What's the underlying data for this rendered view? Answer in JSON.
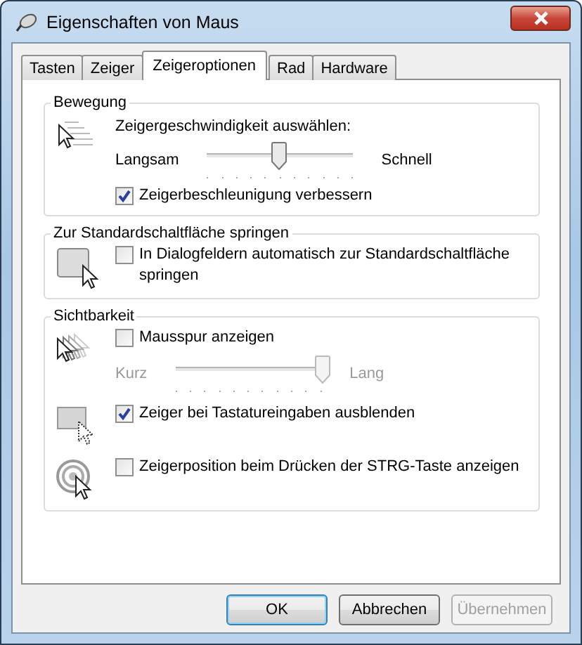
{
  "window": {
    "title": "Eigenschaften von Maus"
  },
  "tabs": [
    {
      "label": "Tasten",
      "selected": false
    },
    {
      "label": "Zeiger",
      "selected": false
    },
    {
      "label": "Zeigeroptionen",
      "selected": true
    },
    {
      "label": "Rad",
      "selected": false
    },
    {
      "label": "Hardware",
      "selected": false
    }
  ],
  "groups": [
    {
      "title": "Bewegung",
      "blocks": [
        {
          "rows": [
            {
              "kind": "text",
              "text": "Zeigergeschwindigkeit auswählen:"
            },
            {
              "kind": "slider",
              "min_label": "Langsam",
              "max_label": "Schnell",
              "level": 0.49,
              "disabled": false
            },
            {
              "kind": "checkbox",
              "label": "Zeigerbeschleunigung verbessern",
              "checked": true
            }
          ]
        }
      ]
    },
    {
      "title": "Zur Standardschaltfläche springen",
      "blocks": [
        {
          "rows": [
            {
              "kind": "checkbox",
              "label": "In Dialogfeldern automatisch zur Standardschaltfläche springen",
              "checked": false
            }
          ]
        }
      ]
    },
    {
      "title": "Sichtbarkeit",
      "blocks": [
        {
          "rows": [
            {
              "kind": "checkbox",
              "label": "Mausspur anzeigen",
              "checked": false
            },
            {
              "kind": "slider",
              "min_label": "Kurz",
              "max_label": "Lang",
              "level": 1.0,
              "disabled": true
            }
          ]
        },
        {
          "rows": [
            {
              "kind": "checkbox",
              "label": "Zeiger bei Tastatureingaben ausblenden",
              "checked": true
            }
          ]
        },
        {
          "rows": [
            {
              "kind": "checkbox",
              "label": "Zeigerposition beim Drücken der STRG-Taste anzeigen",
              "checked": false
            }
          ]
        }
      ]
    }
  ],
  "buttons": [
    {
      "label": "OK",
      "default": true,
      "disabled": false
    },
    {
      "label": "Abbrechen",
      "default": false,
      "disabled": false
    },
    {
      "label": "Übernehmen",
      "default": false,
      "disabled": true
    }
  ]
}
